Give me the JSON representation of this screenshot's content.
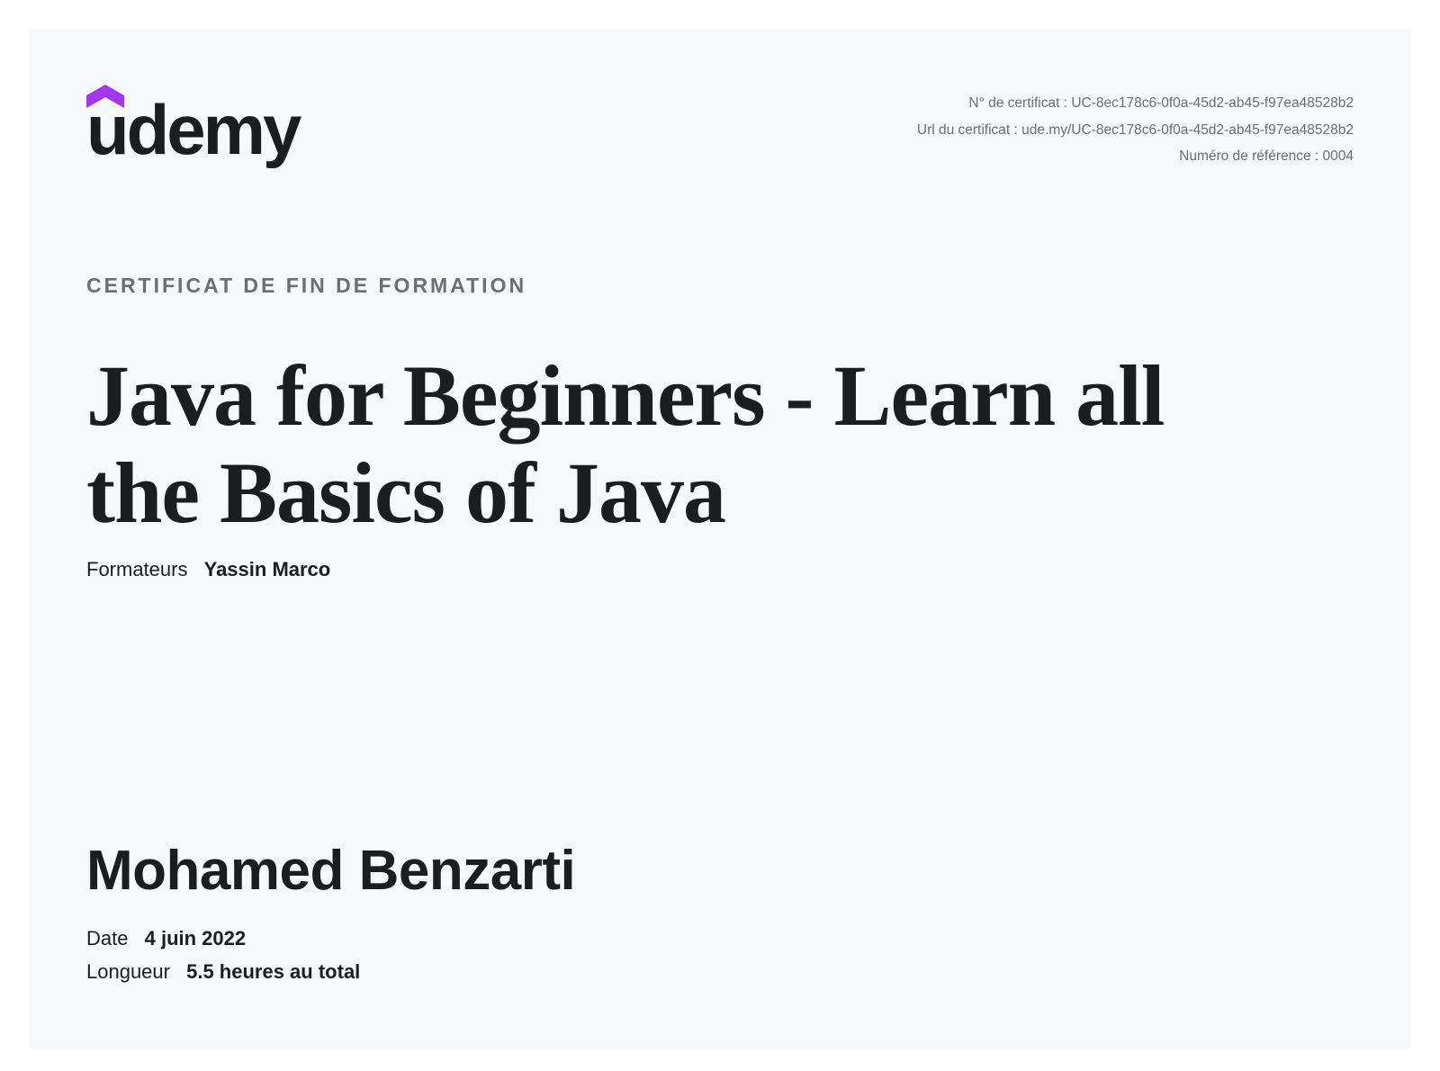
{
  "brand": {
    "name": "udemy",
    "accent_color": "#a435f0",
    "logo_mark_icon": "udemy-hat-icon"
  },
  "certificate_meta": {
    "number_label": "N° de certificat :",
    "number_value": "UC-8ec178c6-0f0a-45d2-ab45-f97ea48528b2",
    "url_label": "Url du certificat :",
    "url_value": "ude.my/UC-8ec178c6-0f0a-45d2-ab45-f97ea48528b2",
    "reference_label": "Numéro de référence :",
    "reference_value": "0004"
  },
  "certificate": {
    "kicker": "Certificat de fin de formation",
    "course_title": "Java for Beginners - Learn all the Basics of Java",
    "instructors_label": "Formateurs",
    "instructors_value": "Yassin Marco",
    "student_name": "Mohamed Benzarti",
    "date_label": "Date",
    "date_value": "4 juin 2022",
    "length_label": "Longueur",
    "length_value": "5.5 heures au total"
  }
}
